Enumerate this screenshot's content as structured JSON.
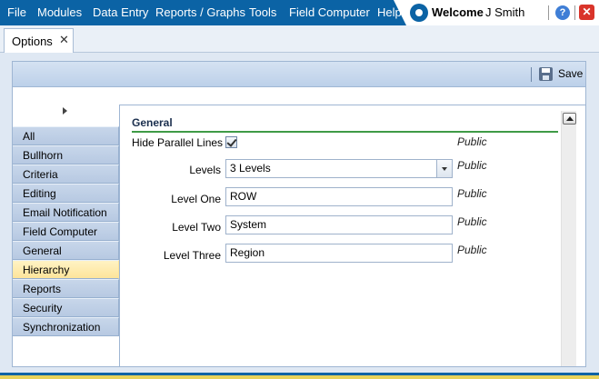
{
  "menu": [
    "File",
    "Modules",
    "Data Entry",
    "Reports / Graphs",
    "Tools",
    "Field Computer",
    "Help"
  ],
  "user": {
    "welcome": "Welcome",
    "name": "J Smith",
    "help_glyph": "?",
    "close_glyph": "✕"
  },
  "tab": {
    "label": "Options",
    "close_glyph": "✕"
  },
  "toolbar": {
    "save_label": "Save"
  },
  "nav": {
    "items": [
      "All",
      "Bullhorn",
      "Criteria",
      "Editing",
      "Email Notification",
      "Field Computer",
      "General",
      "Hierarchy",
      "Reports",
      "Security",
      "Synchronization"
    ],
    "active": "Hierarchy"
  },
  "section": {
    "title": "General",
    "rows": {
      "hide_parallel": {
        "label": "Hide Parallel Lines",
        "checked": true,
        "scope": "Public"
      },
      "levels": {
        "label": "Levels",
        "value": "3 Levels",
        "scope": "Public"
      },
      "level_one": {
        "label": "Level One",
        "value": "ROW",
        "scope": "Public"
      },
      "level_two": {
        "label": "Level Two",
        "value": "System",
        "scope": "Public"
      },
      "level_three": {
        "label": "Level Three",
        "value": "Region",
        "scope": "Public"
      }
    }
  },
  "colors": {
    "menubar": "#0b63a5",
    "accent_rule": "#3f9b46",
    "active_nav": "#fde49a"
  },
  "icons": [
    "app-logo-icon",
    "help-icon",
    "close-app-icon",
    "tab-close-icon",
    "save-icon",
    "collapse-arrow-icon",
    "checkmark-icon",
    "dropdown-arrow-icon",
    "scroll-up-icon"
  ]
}
